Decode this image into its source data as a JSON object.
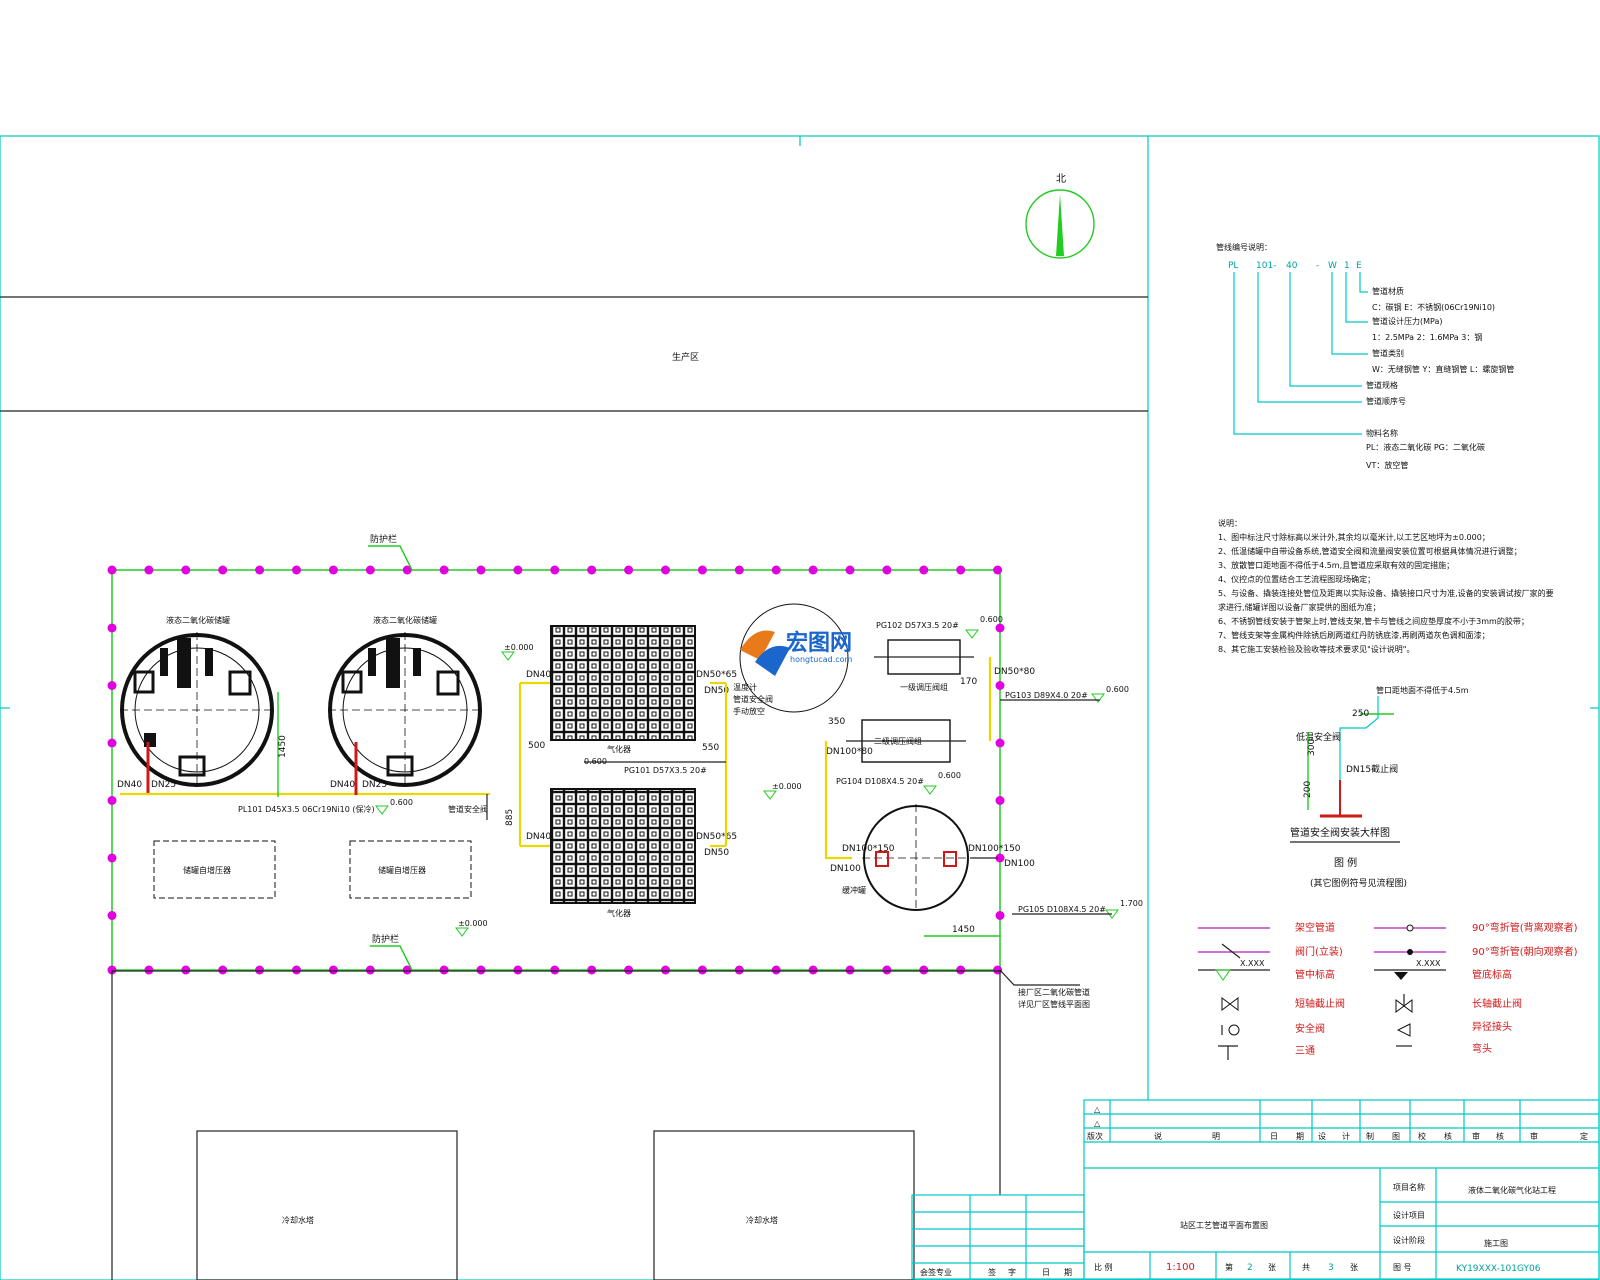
{
  "colors": {
    "frame": "#00c8c8",
    "pipe": "#e8d800",
    "fence": "#22cc22",
    "post": "#e000e0",
    "legend_text": "#d01818"
  },
  "north": {
    "label": "北"
  },
  "areas": {
    "production": "生产区",
    "cooling_tower_1": "冷却水塔",
    "cooling_tower_2": "冷却水塔"
  },
  "tanks": {
    "tank1_label": "液态二氧化碳储罐",
    "tank2_label": "液态二氧化碳储罐",
    "pump1_label": "储罐自增压器",
    "pump2_label": "储罐自增压器",
    "dn40": "DN40",
    "dn25": "DN25",
    "dim_1450": "1450"
  },
  "vaporizers": {
    "label_top": "气化器",
    "label_bottom": "气化器",
    "dn40": "DN40",
    "dn50_65": "DN50*65",
    "dn50": "DN50",
    "dim_500": "500",
    "dim_550": "550",
    "dim_885": "885",
    "valve_notes": [
      "温度计",
      "管道安全阀",
      "手动放空"
    ]
  },
  "regulators": {
    "first": "一级调压阀组",
    "second": "二级调压阀组",
    "dn100_80": "DN100*80",
    "dim_350": "350",
    "dim_170": "170"
  },
  "buffer": {
    "label": "缓冲罐",
    "dn100_150_l": "DN100*150",
    "dn100_150_r": "DN100*150",
    "dn100_l": "DN100",
    "dn100_r": "DN100"
  },
  "pipes": {
    "pl101": "PL101 D45X3.5 06Cr19Ni10 (保冷)",
    "pg101": "PG101 D57X3.5 20#",
    "pg102": "PG102 D57X3.5 20#",
    "pg103": "PG103 D89X4.0 20#",
    "pg104": "PG104 D108X4.5 20#",
    "pg105": "PG105 D108X4.5 20#",
    "dn50_80": "DN50*80",
    "valve_tag": "管道安全阀"
  },
  "elevations": {
    "e0": "±0.000",
    "e0_2": "±0.000",
    "e0_3": "±0.000",
    "e600_a": "0.600",
    "e600_b": "0.600",
    "e600_c": "0.600",
    "e600_d": "0.600",
    "e600_e": "0.600",
    "e1700": "1.700",
    "dim_1450b": "1450"
  },
  "fence": {
    "label_top": "防护栏",
    "label_bottom": "防护栏",
    "exit_note_1": "接厂区二氧化碳管道",
    "exit_note_2": "详见厂区管线平面图"
  },
  "code_legend": {
    "title": "管线编号说明：",
    "code": [
      "PL",
      "101-",
      "40",
      "-",
      "W",
      "1",
      "E"
    ],
    "lines": [
      "管道材质",
      "C：碳钢  E：不锈钢(06Cr19Ni10)",
      "管道设计压力(MPa)",
      "1：2.5MPa  2：1.6MPa  3：钢",
      "管道类别",
      "W：无缝钢管   Y：直缝钢管   L：螺旋钢管",
      "管道规格",
      "管道顺序号",
      "物料名称",
      "PL：液态二氧化碳  PG：二氧化碳",
      "VT：放空管"
    ]
  },
  "notes": {
    "title": "说明：",
    "items": [
      "1、图中标注尺寸除标高以米计外,其余均以毫米计,以工艺区地坪为±0.000；",
      "2、低温储罐中自带设备系统,管道安全阀和流量阀安装位置可根据具体情况进行调整；",
      "3、放散管口距地面不得低于4.5m,且管道应采取有效的固定措施；",
      "4、仪控点的位置结合工艺流程图现场确定；",
      "5、与设备、撬装连接处管位及距离以实际设备、撬装接口尺寸为准,设备的安装调试按厂家的要",
      "   求进行,储罐详图以设备厂家提供的图纸为准；",
      "6、不锈钢管线安装于管架上时,管线支架,管卡与管线之间应垫厚度不小于3mm的胶带；",
      "7、管线支架等金属构件除锈后刷两道红丹防锈底漆,再刷两道灰色调和面漆；",
      "8、其它施工安装检验及验收等技术要求见\"设计说明\"。"
    ]
  },
  "detail": {
    "title": "管道安全阀安装大样图",
    "top_note": "管口距地面不得低于4.5m",
    "valve": "低温安全阀",
    "stop": "DN15截止阀",
    "d250": "250",
    "d300": "300",
    "d200": "200"
  },
  "legend": {
    "title": "图 例",
    "subtitle": "(其它图例符号见流程图)",
    "left": [
      "架空管道",
      "阀门(立装)",
      "管中标高",
      "短轴截止阀",
      "安全阀",
      "三通"
    ],
    "right": [
      "90°弯折管(背离观察者)",
      "90°弯折管(朝向观察者)",
      "管底标高",
      "长轴截止阀",
      "异径接头",
      "弯头"
    ],
    "xxx": "X.XXX"
  },
  "watermark": {
    "brand": "宏图网",
    "url": "hongtucad.com"
  },
  "title_block": {
    "rev_headers": [
      "版次",
      "说",
      "明",
      "日",
      "期",
      "设",
      "计",
      "制",
      "图",
      "校",
      "核",
      "审",
      "核",
      "审",
      "定"
    ],
    "project_label": "项目名称",
    "project_name": "液体二氧化碳气化站工程",
    "design_item": "设计项目",
    "design_stage": "设计阶段",
    "stage_value": "施工图",
    "drawing_title": "站区工艺管道平面布置图",
    "scale_label": "比 例",
    "scale_value": "1:100",
    "sheet_a": "第",
    "sheet_no": "2",
    "sheet_b": "张",
    "total_a": "共",
    "total_no": "3",
    "total_b": "张",
    "drawing_no_label": "图 号",
    "drawing_no": "KY19XXX-101GY06",
    "sign_headers": [
      "会签专业",
      "签",
      "字",
      "日",
      "期"
    ]
  }
}
